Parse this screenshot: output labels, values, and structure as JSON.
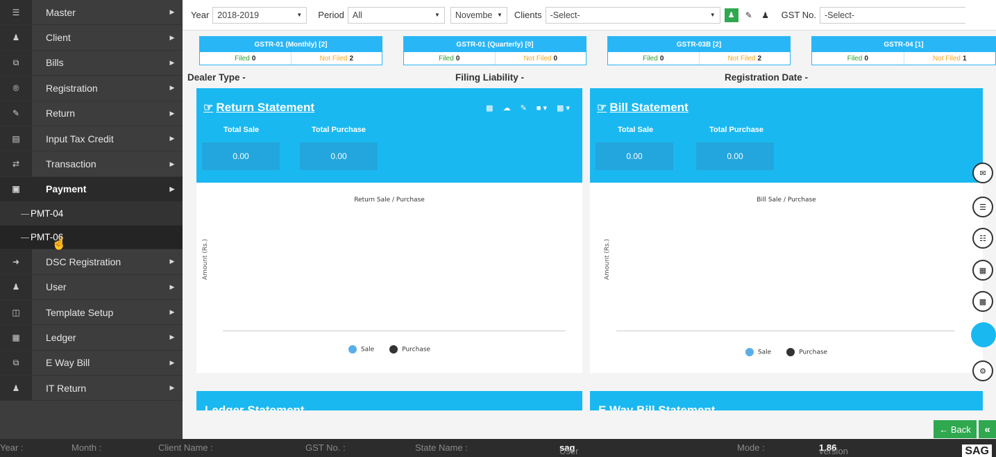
{
  "sidebar": {
    "items": [
      {
        "label": "Master",
        "icon": "database-icon"
      },
      {
        "label": "Client",
        "icon": "users-icon"
      },
      {
        "label": "Bills",
        "icon": "copy-icon"
      },
      {
        "label": "Registration",
        "icon": "registered-icon"
      },
      {
        "label": "Return",
        "icon": "edit-icon"
      },
      {
        "label": "Input Tax Credit",
        "icon": "credit-card-icon"
      },
      {
        "label": "Transaction",
        "icon": "exchange-icon"
      },
      {
        "label": "Payment",
        "icon": "money-icon"
      },
      {
        "label": "DSC Registration",
        "icon": "sign-in-icon"
      },
      {
        "label": "User",
        "icon": "user-plus-icon"
      },
      {
        "label": "Template Setup",
        "icon": "columns-icon"
      },
      {
        "label": "Ledger",
        "icon": "calculator-icon"
      },
      {
        "label": "E Way Bill",
        "icon": "copy-icon"
      },
      {
        "label": "IT Return",
        "icon": "users-icon"
      }
    ],
    "payment_sub": [
      "PMT-04",
      "PMT-06"
    ]
  },
  "filters": {
    "year_label": "Year",
    "year_value": "2018-2019",
    "period_label": "Period",
    "period_value": "All",
    "month_value": "Novembe",
    "clients_label": "Clients",
    "clients_value": "-Select-",
    "gst_label": "GST No.",
    "gst_value": "-Select-"
  },
  "gstr": [
    {
      "title": "GSTR-01 (Monthly) [2]",
      "filed_label": "Filed",
      "filed": "0",
      "notfiled_label": "Not Filed",
      "notfiled": "2"
    },
    {
      "title": "GSTR-01 (Quarterly) [0]",
      "filed_label": "Filed",
      "filed": "0",
      "notfiled_label": "Not Filed",
      "notfiled": "0"
    },
    {
      "title": "GSTR-03B [2]",
      "filed_label": "Filed",
      "filed": "0",
      "notfiled_label": "Not Filed",
      "notfiled": "2"
    },
    {
      "title": "GSTR-04 [1]",
      "filed_label": "Filed",
      "filed": "0",
      "notfiled_label": "Not Filed",
      "notfiled": "1"
    }
  ],
  "info": {
    "dealer_type": "Dealer Type -",
    "filing_liability": "Filing Liability -",
    "registration_date": "Registration Date -"
  },
  "return_panel": {
    "title": "Return Statement",
    "total_sale_label": "Total Sale",
    "total_sale": "0.00",
    "total_purchase_label": "Total Purchase",
    "total_purchase": "0.00",
    "chart_title": "Return Sale / Purchase",
    "ylabel": "Amount (Rs.)",
    "legend_sale": "Sale",
    "legend_purchase": "Purchase"
  },
  "bill_panel": {
    "title": "Bill Statement",
    "total_sale_label": "Total Sale",
    "total_sale": "0.00",
    "total_purchase_label": "Total Purchase",
    "total_purchase": "0.00",
    "chart_title": "Bill Sale / Purchase",
    "ylabel": "Amount (Rs.)",
    "legend_sale": "Sale",
    "legend_purchase": "Purchase"
  },
  "lower_panels": {
    "ledger_title": "Ledger Statement",
    "eway_title": "E Way Bill Statement"
  },
  "back_label": "Back",
  "status": {
    "year_label": "Year :",
    "month_label": "Month :",
    "client_label": "Client Name :",
    "gst_label": "GST No. :",
    "state_label": "State Name :",
    "user_label": "User Name :",
    "user_value": "sag",
    "mode_label": "Mode :",
    "version_label": "version No :",
    "version_value": "1.86",
    "logo": "SAG"
  },
  "colors": {
    "accent": "#1ab8f0",
    "sidebar_bg": "#3d3d3d",
    "green": "#2fa84f",
    "sale": "#5aaee8",
    "purchase": "#333333"
  }
}
